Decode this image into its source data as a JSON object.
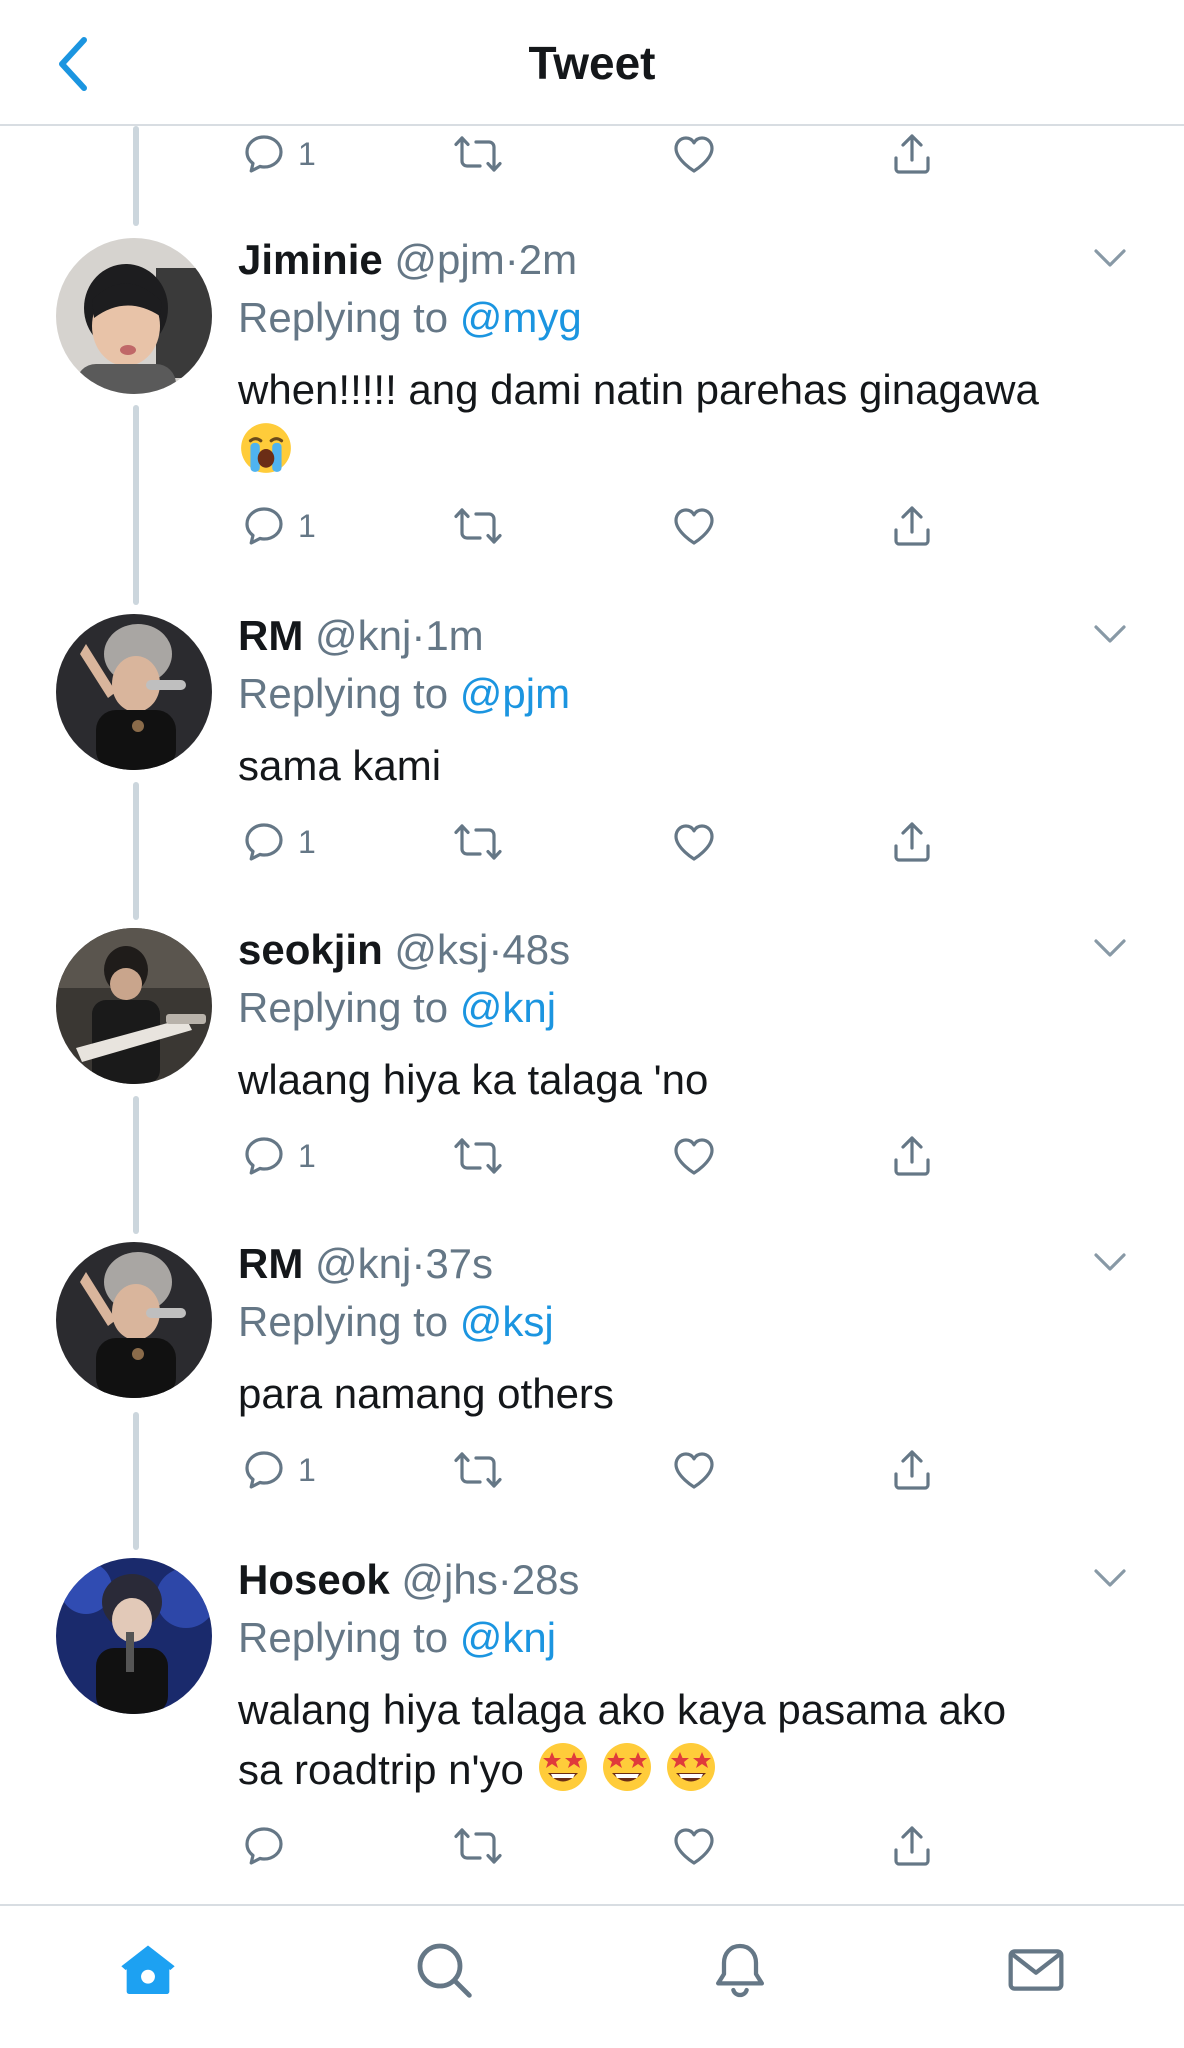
{
  "header": {
    "title": "Tweet"
  },
  "top_actions": {
    "reply_count": "1"
  },
  "tweets": [
    {
      "name": "Jiminie",
      "handle": "@pjm",
      "time": "2m",
      "replying_prefix": "Replying to ",
      "replying_to": "@myg",
      "text": "when!!!!! ang dami natin parehas ginagawa",
      "emojis": [
        "loudly-crying-face"
      ],
      "reply_count": "1"
    },
    {
      "name": "RM",
      "handle": "@knj",
      "time": "1m",
      "replying_prefix": "Replying to ",
      "replying_to": "@pjm",
      "text": "sama kami",
      "reply_count": "1"
    },
    {
      "name": "seokjin",
      "handle": "@ksj",
      "time": "48s",
      "replying_prefix": "Replying to ",
      "replying_to": "@knj",
      "text": "wlaang hiya ka talaga 'no",
      "reply_count": "1"
    },
    {
      "name": "RM",
      "handle": "@knj",
      "time": "37s",
      "replying_prefix": "Replying to ",
      "replying_to": "@ksj",
      "text": "para namang others",
      "reply_count": "1"
    },
    {
      "name": "Hoseok",
      "handle": "@jhs",
      "time": "28s",
      "replying_prefix": "Replying to ",
      "replying_to": "@knj",
      "text_line1": "walang hiya talaga ako kaya pasama ako",
      "text_line2": "sa roadtrip n'yo",
      "emojis": [
        "star-struck",
        "star-struck",
        "star-struck"
      ],
      "reply_count": ""
    }
  ],
  "separator": "·",
  "tabbar": {
    "items": [
      "home-icon",
      "search-icon",
      "notifications-icon",
      "messages-icon"
    ],
    "active": "home-icon"
  },
  "colors": {
    "accent": "#1b95e0",
    "gray": "#657786",
    "icon": "#657786",
    "thread": "#ccd6dd"
  }
}
